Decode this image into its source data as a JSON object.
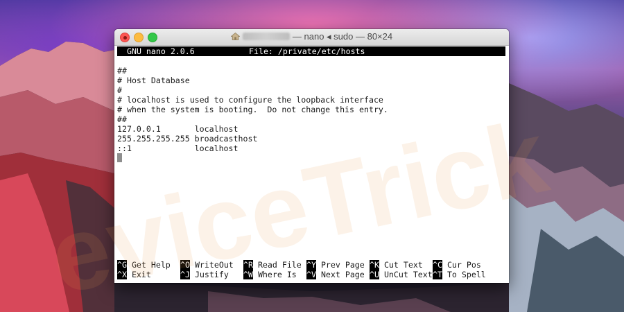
{
  "window": {
    "title_user": "",
    "title": "— nano ◂ sudo — 80×24"
  },
  "nano": {
    "version": "GNU nano 2.0.6",
    "file": "File: /private/etc/hosts"
  },
  "file_lines": [
    "##",
    "# Host Database",
    "#",
    "# localhost is used to configure the loopback interface",
    "# when the system is booting.  Do not change this entry.",
    "##",
    "127.0.0.1       localhost",
    "255.255.255.255 broadcasthost",
    "::1             localhost"
  ],
  "shortcuts": {
    "row1": [
      {
        "key": "^G",
        "label": " Get Help"
      },
      {
        "key": "^O",
        "label": " WriteOut"
      },
      {
        "key": "^R",
        "label": " Read File"
      },
      {
        "key": "^Y",
        "label": " Prev Page"
      },
      {
        "key": "^K",
        "label": " Cut Text"
      },
      {
        "key": "^C",
        "label": " Cur Pos"
      }
    ],
    "row2": [
      {
        "key": "^X",
        "label": " Exit"
      },
      {
        "key": "^J",
        "label": " Justify"
      },
      {
        "key": "^W",
        "label": " Where Is"
      },
      {
        "key": "^V",
        "label": " Next Page"
      },
      {
        "key": "^U",
        "label": " UnCut Text"
      },
      {
        "key": "^T",
        "label": " To Spell"
      }
    ]
  },
  "watermark": "eviceTrick",
  "colors": {
    "close": "#fc5753",
    "minimize": "#fdbc40",
    "maximize": "#33c748",
    "header_bg": "#000000",
    "terminal_bg": "#ffffff"
  }
}
